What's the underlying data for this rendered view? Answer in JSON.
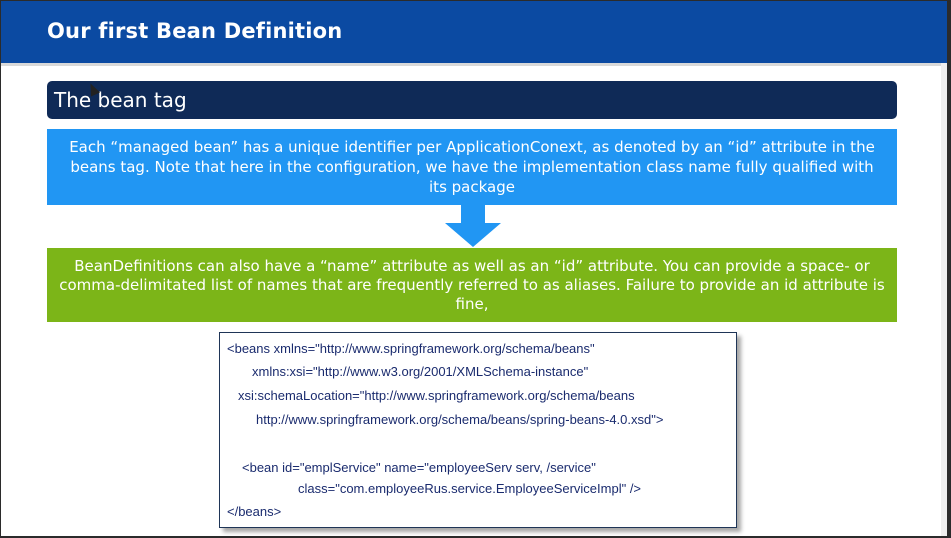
{
  "slide": {
    "title": "Our first Bean Definition",
    "section_header": "The bean tag",
    "blue_box_text": "Each “managed bean” has a unique identifier per ApplicationConext, as denoted by an “id” attribute in the beans tag. Note that here in the configuration, we have the implementation class name fully qualified with its package",
    "green_box_text": "BeanDefinitions can also have a “name” attribute as well as an “id” attribute. You can provide a space- or comma-delimitated list of names that are frequently referred to as aliases. Failure to provide an id attribute is fine,",
    "code_lines": [
      "<beans xmlns=\"http://www.springframework.org/schema/beans\"",
      "xmlns:xsi=\"http://www.w3.org/2001/XMLSchema-instance\"",
      "xsi:schemaLocation=\"http://www.springframework.org/schema/beans",
      "http://www.springframework.org/schema/beans/spring-beans-4.0.xsd\">",
      "<bean id=\"emplService\" name=\"employeeServ serv, /service\"",
      "class=\"com.employeeRus.service.EmployeeServiceImpl\" />",
      "</beans>"
    ]
  },
  "colors": {
    "title_bar": "#0b4aa2",
    "section_header": "#0f2a57",
    "blue_box": "#2196f3",
    "green_box": "#7cb518",
    "code_text": "#1a2b6e"
  },
  "icons": {
    "arrow": "down-arrow-icon",
    "cursor": "mouse-cursor-icon"
  }
}
